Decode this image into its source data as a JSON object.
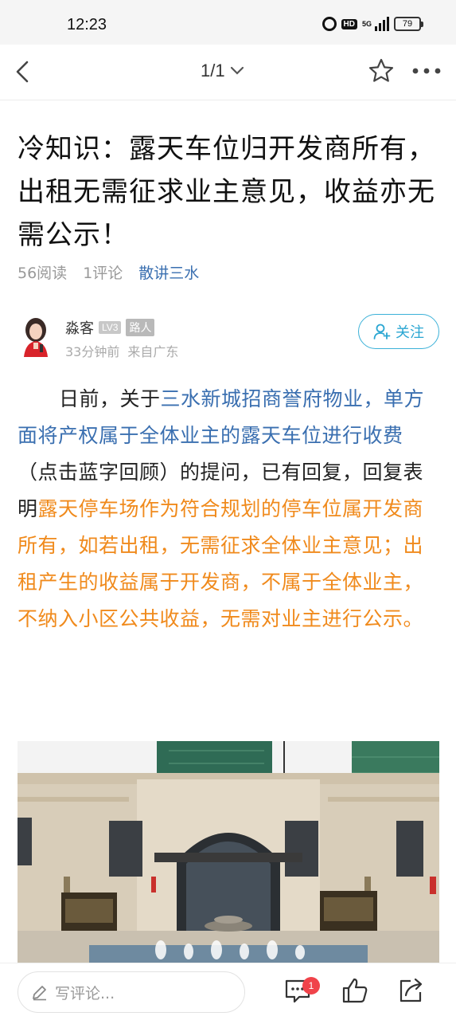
{
  "status_bar": {
    "time": "12:23",
    "hd": "HD",
    "network": "5G",
    "battery": "79"
  },
  "nav": {
    "page_indicator": "1/1"
  },
  "article": {
    "title": "冷知识：露天车位归开发商所有，出租无需征求业主意见，收益亦无需公示！",
    "reads": "56阅读",
    "comments": "1评论",
    "source": "散讲三水",
    "author": {
      "name": "淼客",
      "level": "LV3",
      "role": "路人",
      "time": "33分钟前",
      "location": "来自广东"
    },
    "follow_label": "关注",
    "body": {
      "part1": "日前，关于",
      "link": "三水新城招商誉府物业，单方面将产权属于全体业主的露天车位进行收费",
      "part2": "（点击蓝字回顾）的提问，已有回复，回复表明",
      "highlight": "露天停车场作为符合规划的停车位属开发商所有，如若出租，无需征求全体业主意见；出租产生的收益属于开发商，不属于全体业主，不纳入小区公共收益，无需对业主进行公示。"
    }
  },
  "bottom_bar": {
    "comment_placeholder": "写评论...",
    "comment_count": "1"
  },
  "colors": {
    "link": "#3a6fb0",
    "highlight": "#f08a1c",
    "follow": "#2aa6d2",
    "badge_red": "#f0434a"
  },
  "icons": [
    "back-icon",
    "chevron-down-icon",
    "star-icon",
    "more-icon",
    "add-user-icon",
    "pen-icon",
    "comment-icon",
    "thumbs-up-icon",
    "share-icon"
  ]
}
